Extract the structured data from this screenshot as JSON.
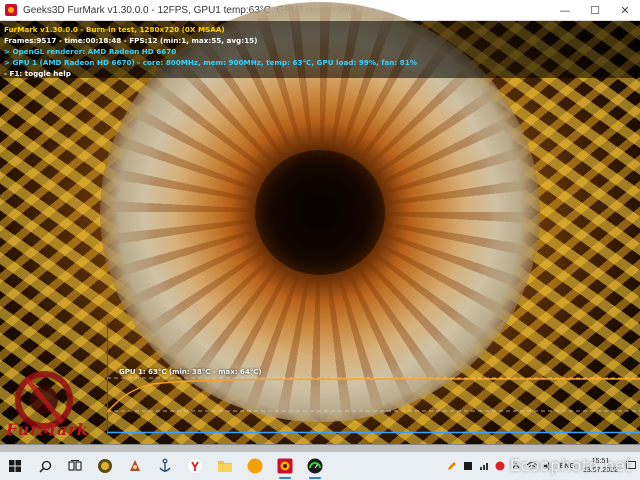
{
  "window": {
    "title": "Geeks3D FurMark v1.30.0.0 - 12FPS, GPU1 temp:63°C, GPU1 usage:99%",
    "minimize_glyph": "—",
    "maximize_glyph": "☐",
    "close_glyph": "✕"
  },
  "osd": {
    "lines": [
      {
        "text": "FurMark v1.30.0.0 - Burn-in test, 1280x720 (0X MSAA)",
        "color": "#ffd400"
      },
      {
        "text": "Frames:9517 - time:00:18:48 - FPS:12 (min:1, max:55, avg:15)",
        "color": "#ffffff"
      },
      {
        "text": "> OpenGL renderer: AMD Radeon HD 6670",
        "color": "#37d2ff"
      },
      {
        "text": "> GPU 1 (AMD Radeon HD 6670) - core: 800MHz, mem: 900MHz, temp: 63°C, GPU load: 99%, fan: 81%",
        "color": "#37d2ff"
      },
      {
        "text": "- F1: toggle help",
        "color": "#ffffff"
      }
    ]
  },
  "graph": {
    "label": "GPU 1: 63°C (min: 38°C - max: 64°C)",
    "temp_min": 38,
    "temp_max": 64,
    "temp_current": 63,
    "line_color": "#ffa21a",
    "axis_color": "#3aa0ff"
  },
  "logo": {
    "text": "FurMark"
  },
  "taskbar": {
    "items": [
      {
        "name": "start-button",
        "icon": "windows-logo-icon",
        "active": false
      },
      {
        "name": "search-button",
        "icon": "search-icon",
        "active": false
      },
      {
        "name": "task-view-button",
        "icon": "task-view-icon",
        "active": false
      },
      {
        "name": "taskbar-app-gpu-tool",
        "icon": "gpu-tool-icon",
        "active": false
      },
      {
        "name": "taskbar-app-cheat-engine",
        "icon": "cheat-engine-icon",
        "active": false
      },
      {
        "name": "taskbar-app-anchor",
        "icon": "anchor-icon",
        "active": false
      },
      {
        "name": "taskbar-app-yandex",
        "icon": "yandex-browser-icon",
        "active": false
      },
      {
        "name": "taskbar-app-explorer",
        "icon": "folder-icon",
        "active": false
      },
      {
        "name": "taskbar-app-orange",
        "icon": "orange-circle-icon",
        "active": false
      },
      {
        "name": "taskbar-app-furmark",
        "icon": "furmark-icon",
        "active": true
      },
      {
        "name": "taskbar-app-monitor",
        "icon": "gauge-icon",
        "active": true
      }
    ],
    "tray": {
      "language": "ENG",
      "time": "15:51",
      "date": "13.07.2022"
    }
  },
  "watermark": "Ecoophoto.net"
}
